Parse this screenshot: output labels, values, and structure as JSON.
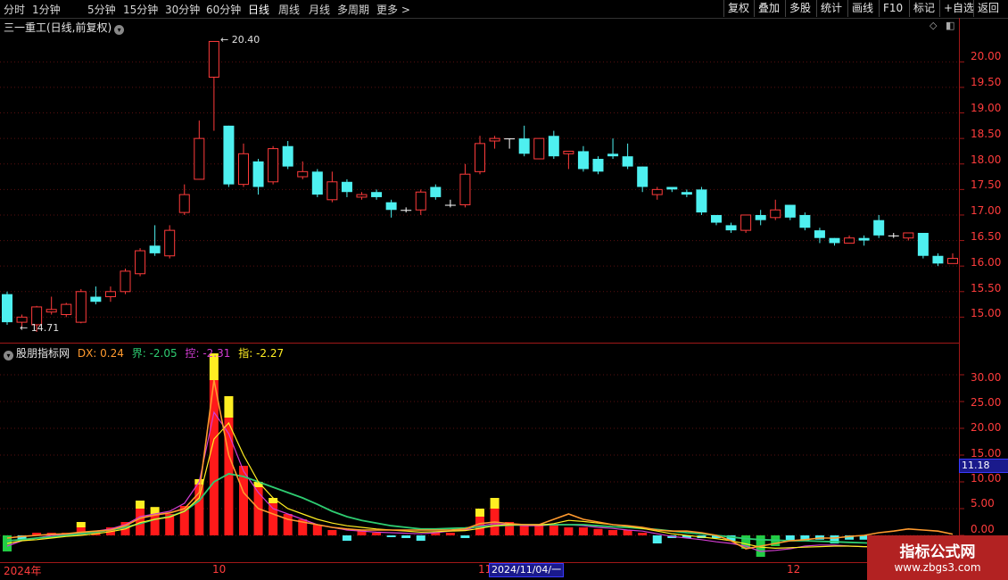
{
  "toolbar": {
    "periods": [
      "分时",
      "1分钟",
      "5分钟",
      "15分钟",
      "30分钟",
      "60分钟",
      "日线",
      "周线",
      "月线",
      "多周期",
      "更多 >"
    ],
    "active": "日线",
    "right_buttons": [
      "复权",
      "叠加",
      "多股",
      "统计",
      "画线",
      "F10",
      "标记",
      "+自选",
      "返回"
    ]
  },
  "chart_title": "三一重工(日线,前复权)",
  "price_axis": [
    "20.00",
    "19.50",
    "19.00",
    "18.50",
    "18.00",
    "17.50",
    "17.00",
    "16.50",
    "16.00",
    "15.50",
    "15.00"
  ],
  "annotations": {
    "high": "20.40",
    "low": "14.71"
  },
  "indicator": {
    "name": "股朋指标网",
    "dx": "DX: 0.24",
    "jie": "界: -2.05",
    "kong": "控: -2.31",
    "zhi": "指: -2.27",
    "axis": [
      "30.00",
      "25.00",
      "20.00",
      "15.00",
      "10.00",
      "5.00",
      "0.00"
    ],
    "current": "11.18"
  },
  "time_axis": [
    "2024年",
    "10",
    "11",
    "12"
  ],
  "crosshair_date": "2024/11/04/一",
  "watermark": {
    "line1": "指标公式网",
    "line2": "www.zbgs3.com"
  },
  "colors": {
    "up": "#ff3b3b",
    "down": "#4ef0f0",
    "orange": "#ff9a2e",
    "green": "#2ecc71",
    "magenta": "#d23cd2",
    "yellow": "#ffee22"
  },
  "chart_data": {
    "type": "candlestick",
    "ylim": [
      14.5,
      20.6
    ],
    "candles": [
      [
        15.45,
        14.9,
        15.5,
        14.85
      ],
      [
        14.9,
        15.0,
        15.05,
        14.8
      ],
      [
        14.85,
        15.2,
        15.22,
        14.71
      ],
      [
        15.1,
        15.15,
        15.4,
        15.05
      ],
      [
        15.05,
        15.25,
        15.28,
        15.0
      ],
      [
        14.9,
        15.5,
        15.55,
        14.88
      ],
      [
        15.4,
        15.3,
        15.6,
        15.25
      ],
      [
        15.4,
        15.5,
        15.6,
        15.3
      ],
      [
        15.5,
        15.9,
        15.95,
        15.45
      ],
      [
        15.85,
        16.3,
        16.35,
        15.8
      ],
      [
        16.4,
        16.25,
        16.8,
        16.2
      ],
      [
        16.2,
        16.7,
        16.8,
        16.15
      ],
      [
        17.05,
        17.4,
        17.6,
        17.0
      ],
      [
        17.7,
        18.5,
        18.85,
        17.7
      ],
      [
        19.7,
        20.4,
        20.4,
        18.65
      ],
      [
        18.75,
        17.6,
        18.75,
        17.55
      ],
      [
        17.6,
        18.2,
        18.4,
        17.55
      ],
      [
        18.05,
        17.55,
        18.1,
        17.4
      ],
      [
        17.65,
        18.3,
        18.35,
        17.6
      ],
      [
        18.35,
        17.95,
        18.45,
        17.9
      ],
      [
        17.75,
        17.85,
        18.05,
        17.7
      ],
      [
        17.85,
        17.4,
        17.9,
        17.35
      ],
      [
        17.3,
        17.65,
        17.85,
        17.25
      ],
      [
        17.65,
        17.45,
        17.7,
        17.35
      ],
      [
        17.35,
        17.4,
        17.45,
        17.3
      ],
      [
        17.45,
        17.35,
        17.5,
        17.3
      ],
      [
        17.25,
        17.1,
        17.3,
        16.95
      ],
      [
        17.1,
        17.1,
        17.15,
        17.05
      ],
      [
        17.1,
        17.45,
        17.5,
        17.0
      ],
      [
        17.55,
        17.35,
        17.6,
        17.3
      ],
      [
        17.2,
        17.2,
        17.3,
        17.15
      ],
      [
        17.2,
        17.8,
        18.0,
        17.15
      ],
      [
        17.85,
        18.4,
        18.55,
        17.8
      ],
      [
        18.45,
        18.5,
        18.55,
        18.3
      ],
      [
        18.5,
        18.5,
        18.5,
        18.3
      ],
      [
        18.5,
        18.2,
        18.75,
        18.15
      ],
      [
        18.1,
        18.5,
        18.5,
        18.1
      ],
      [
        18.55,
        18.15,
        18.65,
        18.1
      ],
      [
        18.2,
        18.25,
        18.25,
        17.9
      ],
      [
        18.25,
        17.9,
        18.35,
        17.85
      ],
      [
        18.1,
        17.85,
        18.15,
        17.8
      ],
      [
        18.2,
        18.15,
        18.5,
        18.1
      ],
      [
        18.15,
        17.95,
        18.4,
        17.9
      ],
      [
        17.95,
        17.55,
        17.95,
        17.45
      ],
      [
        17.4,
        17.5,
        17.55,
        17.3
      ],
      [
        17.55,
        17.5,
        17.55,
        17.45
      ],
      [
        17.45,
        17.4,
        17.5,
        17.35
      ],
      [
        17.5,
        17.05,
        17.55,
        17.0
      ],
      [
        17.0,
        16.85,
        17.0,
        16.8
      ],
      [
        16.8,
        16.7,
        16.85,
        16.65
      ],
      [
        16.7,
        17.0,
        17.0,
        16.65
      ],
      [
        17.0,
        16.9,
        17.1,
        16.8
      ],
      [
        16.95,
        17.1,
        17.3,
        16.9
      ],
      [
        17.2,
        16.95,
        17.2,
        16.9
      ],
      [
        17.0,
        16.75,
        17.05,
        16.7
      ],
      [
        16.7,
        16.55,
        16.75,
        16.45
      ],
      [
        16.55,
        16.45,
        16.55,
        16.4
      ],
      [
        16.45,
        16.55,
        16.6,
        16.45
      ],
      [
        16.55,
        16.5,
        16.6,
        16.4
      ],
      [
        16.9,
        16.6,
        17.0,
        16.55
      ],
      [
        16.6,
        16.6,
        16.65,
        16.55
      ],
      [
        16.55,
        16.65,
        16.65,
        16.5
      ],
      [
        16.65,
        16.2,
        16.65,
        16.15
      ],
      [
        16.2,
        16.05,
        16.25,
        16.0
      ],
      [
        16.05,
        16.15,
        16.25,
        16.05
      ]
    ],
    "indicator": {
      "ylim": [
        -5,
        34
      ],
      "bars": [
        -3,
        -1,
        0.5,
        0.5,
        0.5,
        1.5,
        0.8,
        1.5,
        2.5,
        5,
        3.8,
        4,
        5.5,
        9.5,
        29,
        22,
        13,
        9,
        6,
        4,
        3,
        2,
        1,
        -1,
        1,
        0.5,
        -0.3,
        -0.5,
        -1,
        0.5,
        0.5,
        -0.5,
        3.5,
        5,
        2.5,
        2,
        2,
        2,
        1.5,
        1.5,
        1.2,
        1,
        1,
        0.5,
        -1.5,
        -0.5,
        -0.5,
        -0.5,
        -0.5,
        -1,
        -2.5,
        -4,
        -2,
        -1,
        -1,
        -0.8,
        -1.5,
        -0.8,
        -0.8,
        -0.5,
        -0.5,
        -0.5,
        -0.5,
        -0.5,
        -0.5
      ],
      "yellow_tops": [
        0,
        0,
        0,
        0,
        0,
        1,
        0,
        0,
        0,
        1.5,
        1.5,
        0,
        0,
        1,
        5,
        4,
        0,
        1,
        1,
        0,
        0,
        0,
        0,
        0,
        0,
        0,
        0,
        0,
        0,
        0,
        0,
        0,
        1.5,
        2,
        0,
        0,
        0,
        0,
        0,
        0,
        0,
        0,
        0,
        0,
        0,
        0,
        0,
        0,
        0,
        0,
        0,
        0,
        0,
        0,
        0,
        0,
        0,
        0,
        0,
        0,
        0,
        0,
        0,
        0,
        0
      ],
      "line_dx": [
        -0.5,
        -0.2,
        0,
        0.2,
        0.3,
        0.6,
        0.8,
        1,
        1.8,
        3.2,
        3.8,
        4.2,
        5,
        8,
        29,
        15,
        8,
        5,
        4,
        3,
        2.5,
        2,
        1.5,
        1.2,
        1,
        1,
        1,
        1,
        1,
        1,
        1,
        1.2,
        2.2,
        2.5,
        2.2,
        2,
        2,
        3,
        4,
        3,
        2.5,
        2,
        1.8,
        1.5,
        1,
        0.8,
        0.8,
        0.5,
        0,
        -1,
        -2.5,
        -2,
        -1.5,
        -1,
        -0.8,
        -0.5,
        -0.5,
        -0.2,
        0,
        0.5,
        0.8,
        1.2,
        1,
        0.8,
        0.24
      ],
      "line_jie": [
        -1,
        -0.8,
        -0.5,
        -0.3,
        0,
        0.3,
        0.6,
        1,
        1.5,
        2.2,
        3,
        3.5,
        4.5,
        6.5,
        10,
        11.5,
        11,
        10,
        9,
        8,
        7,
        5.8,
        4.5,
        3.5,
        2.8,
        2.3,
        1.8,
        1.5,
        1.2,
        1.2,
        1.3,
        1.4,
        1.6,
        1.8,
        1.9,
        2,
        2,
        2,
        2,
        2,
        1.8,
        1.6,
        1.5,
        1.3,
        1.1,
        0.8,
        0.5,
        0.3,
        0,
        -0.3,
        -0.6,
        -0.8,
        -0.9,
        -1,
        -1,
        -1.1,
        -1.2,
        -1.3,
        -1.4,
        -1.5,
        -1.6,
        -1.7,
        -1.8,
        -1.9,
        -2.05
      ],
      "line_kong": [
        -2,
        -1,
        -0.5,
        0,
        0.2,
        0.5,
        0.8,
        1.2,
        2,
        3.5,
        4,
        4.5,
        6,
        10,
        23,
        19,
        12,
        8,
        5,
        4,
        3,
        2,
        1.5,
        1,
        0.8,
        0.6,
        0.5,
        0.4,
        0.3,
        0.5,
        0.8,
        1,
        1.8,
        2.2,
        2,
        1.8,
        1.8,
        2,
        2,
        1.8,
        1.5,
        1.3,
        1,
        0.8,
        0.3,
        -0.2,
        -0.5,
        -0.8,
        -1.2,
        -1.5,
        -2,
        -3,
        -2.8,
        -2.5,
        -2,
        -1.8,
        -1.8,
        -2,
        -2.1,
        -2.2,
        -2.2,
        -2.2,
        -2.3,
        -2.3,
        -2.31
      ],
      "line_zhi": [
        -1.5,
        -1,
        -0.8,
        -0.5,
        -0.2,
        0,
        0.3,
        0.7,
        1.2,
        2.4,
        3,
        3.4,
        4.5,
        7,
        18,
        21,
        15,
        10,
        7,
        5,
        4,
        3,
        2.3,
        1.8,
        1.5,
        1.2,
        1,
        0.8,
        0.6,
        0.7,
        0.8,
        0.9,
        1.3,
        1.8,
        2,
        2,
        1.9,
        2.2,
        2.8,
        2.6,
        2.3,
        2,
        1.7,
        1.3,
        0.8,
        0.3,
        0,
        -0.3,
        -0.6,
        -1,
        -1.6,
        -2.2,
        -2.4,
        -2.3,
        -2.2,
        -2.1,
        -2,
        -2,
        -2.1,
        -2.1,
        -2.2,
        -2.2,
        -2.25,
        -2.27,
        -2.27
      ]
    }
  }
}
